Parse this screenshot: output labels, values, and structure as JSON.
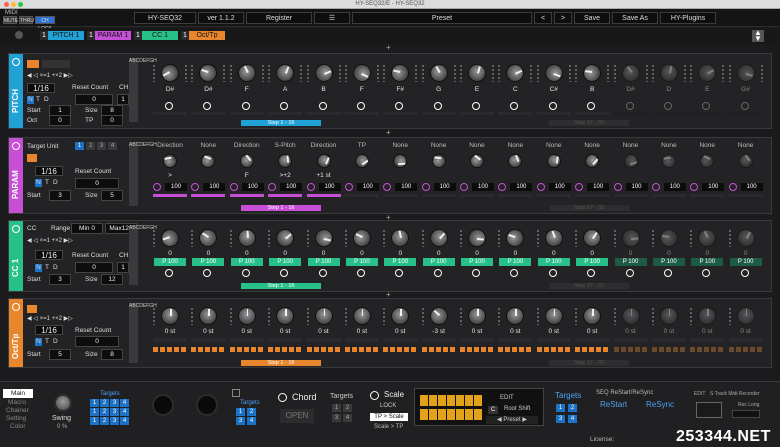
{
  "window": {
    "title": "HY-SEQ32/E - HY-SEQ32"
  },
  "toolbar": {
    "midi_label": "MIDI",
    "mute": "MUTE",
    "thru": "THRU",
    "ch_lock": "CH LOCK",
    "plugin_name": "HY-SEQ32",
    "version": "ver 1.1.2",
    "register": "Register",
    "menu_icon": "hamburger-icon",
    "preset": "Preset",
    "prev": "<",
    "next": ">",
    "save": "Save",
    "save_as": "Save As",
    "plugins": "HY-Plugins"
  },
  "tabs": [
    {
      "num": "1",
      "label": "PITCH 1",
      "color": "#21a2d6"
    },
    {
      "num": "1",
      "label": "PARAM 1",
      "color": "#c64fd6"
    },
    {
      "num": "1",
      "label": "CC 1",
      "color": "#27c089"
    },
    {
      "num": "1",
      "label": "Oct/Tp",
      "color": "#e8862e"
    }
  ],
  "pitch": {
    "color": "#21a2d6",
    "name": "PITCH",
    "rate": "1/16",
    "mode_n": "N",
    "mode_t": "T",
    "mode_d": "D",
    "reset_count_label": "Reset Count",
    "reset_count": "0",
    "ch_label": "CH",
    "ch_value": "1",
    "start_label": "Start",
    "start": "1",
    "size_label": "Size",
    "size": "8",
    "oct_label": "Oct",
    "oct": "0",
    "tp_label": "TP",
    "tp": "0",
    "step_label": "Step  1 - 16",
    "step_label2": "Step  17 - 32",
    "letters": "ABCDEFGH",
    "notes": [
      "D#",
      "D#",
      "F",
      "A",
      "B",
      "F",
      "F#",
      "G",
      "E",
      "C",
      "C#",
      "B",
      "D#",
      "D",
      "E",
      "G#"
    ]
  },
  "param": {
    "color": "#c64fd6",
    "name": "PARAM",
    "target_unit": "Target Unit",
    "units": [
      "1",
      "2",
      "3",
      "4"
    ],
    "rate": "1/16",
    "mode_n": "N",
    "mode_t": "T",
    "mode_d": "D",
    "reset_count_label": "Reset Count",
    "reset_count": "0",
    "start_label": "Start",
    "start": "3",
    "size_label": "Size",
    "size": "5",
    "step_label": "Step  1 - 16",
    "step_label2": "Step  17 - 32",
    "letters": "ABCDEFGH",
    "headers": [
      "Direction",
      "None",
      "Direction",
      "S-Pitch",
      "Direction",
      "TP",
      "None",
      "None",
      "None",
      "None",
      "None",
      "None",
      "None",
      "None",
      "None",
      "None"
    ],
    "values": [
      ">",
      "",
      "F",
      ">+2",
      "+1 st",
      "",
      "",
      "",
      "",
      "",
      "",
      "",
      "",
      "",
      "",
      ""
    ],
    "velocity": [
      "100",
      "100",
      "100",
      "100",
      "100",
      "100",
      "100",
      "100",
      "100",
      "100",
      "100",
      "100",
      "100",
      "100",
      "100",
      "100"
    ]
  },
  "cc": {
    "color": "#27c089",
    "name": "CC 1",
    "cc_label": "CC",
    "range_label": "Range",
    "range_min": "Min",
    "range_min_val": "0",
    "range_max": "Max",
    "range_max_val": "127",
    "rate": "1/16",
    "mode_n": "N",
    "mode_t": "T",
    "mode_d": "D",
    "reset_count_label": "Reset Count",
    "reset_count": "0",
    "ch_label": "CH",
    "ch_value": "1",
    "start_label": "Start",
    "start": "3",
    "size_label": "Size",
    "size": "12",
    "step_label": "Step  1 - 16",
    "step_label2": "Step  17 - 32",
    "letters": "ABCDEFGH",
    "values": [
      "0",
      "0",
      "0",
      "0",
      "0",
      "0",
      "0",
      "0",
      "0",
      "0",
      "0",
      "0",
      "0",
      "0",
      "0",
      "0"
    ],
    "p_values": [
      "P 100",
      "P 100",
      "P 100",
      "P 100",
      "P 100",
      "P 100",
      "P 100",
      "P 100",
      "P 100",
      "P 100",
      "P 100",
      "P 100",
      "P 100",
      "P 100",
      "P 100",
      "P 100"
    ]
  },
  "octtp": {
    "color": "#e8862e",
    "name": "Oct/Tp",
    "rate": "1/16",
    "mode_n": "N",
    "mode_t": "T",
    "mode_d": "D",
    "reset_count_label": "Reset Count",
    "reset_count": "0",
    "start_label": "Start",
    "start": "5",
    "size_label": "Size",
    "size": "8",
    "step_label": "Step  1 - 16",
    "step_label2": "Step  17 - 32",
    "letters": "ABCDEFGH",
    "values": [
      "0 st",
      "0 st",
      "0 st",
      "0 st",
      "0 st",
      "0 st",
      "0 st",
      "-3 st",
      "0 st",
      "0 st",
      "0 st",
      "0 st",
      "0 st",
      "0 st",
      "0 st",
      "0 st"
    ]
  },
  "bottom": {
    "main": "Main",
    "macro": "Macro",
    "chainer": "Chainer",
    "setting": "Setting",
    "color": "Color",
    "swing_label": "Swing",
    "swing_value": "0 %",
    "targets_label": "Targets",
    "targets": [
      "1",
      "2",
      "3",
      "4"
    ],
    "chord_label": "Chord",
    "chord_open": "OPEN",
    "chord_targets": "Targets",
    "scale_label": "Scale",
    "scale_lock": "LOCK",
    "scale_tp": "TP > Scale",
    "scale_tp2": "Scale > TP",
    "edit_label": "EDIT",
    "root_shift": "Root Shift",
    "root_key": "C",
    "preset_label": "Preset",
    "targets2_label": "Targets",
    "seq_reset_label": "SEQ ReStart/ReSync",
    "restart": "ReStart",
    "resync": "ReSync",
    "edit2": "EDIT",
    "recorder": "S Track Midi Recorder",
    "rec_long": "Rec Long",
    "license": "License:",
    "watermark": "253344.NET"
  }
}
